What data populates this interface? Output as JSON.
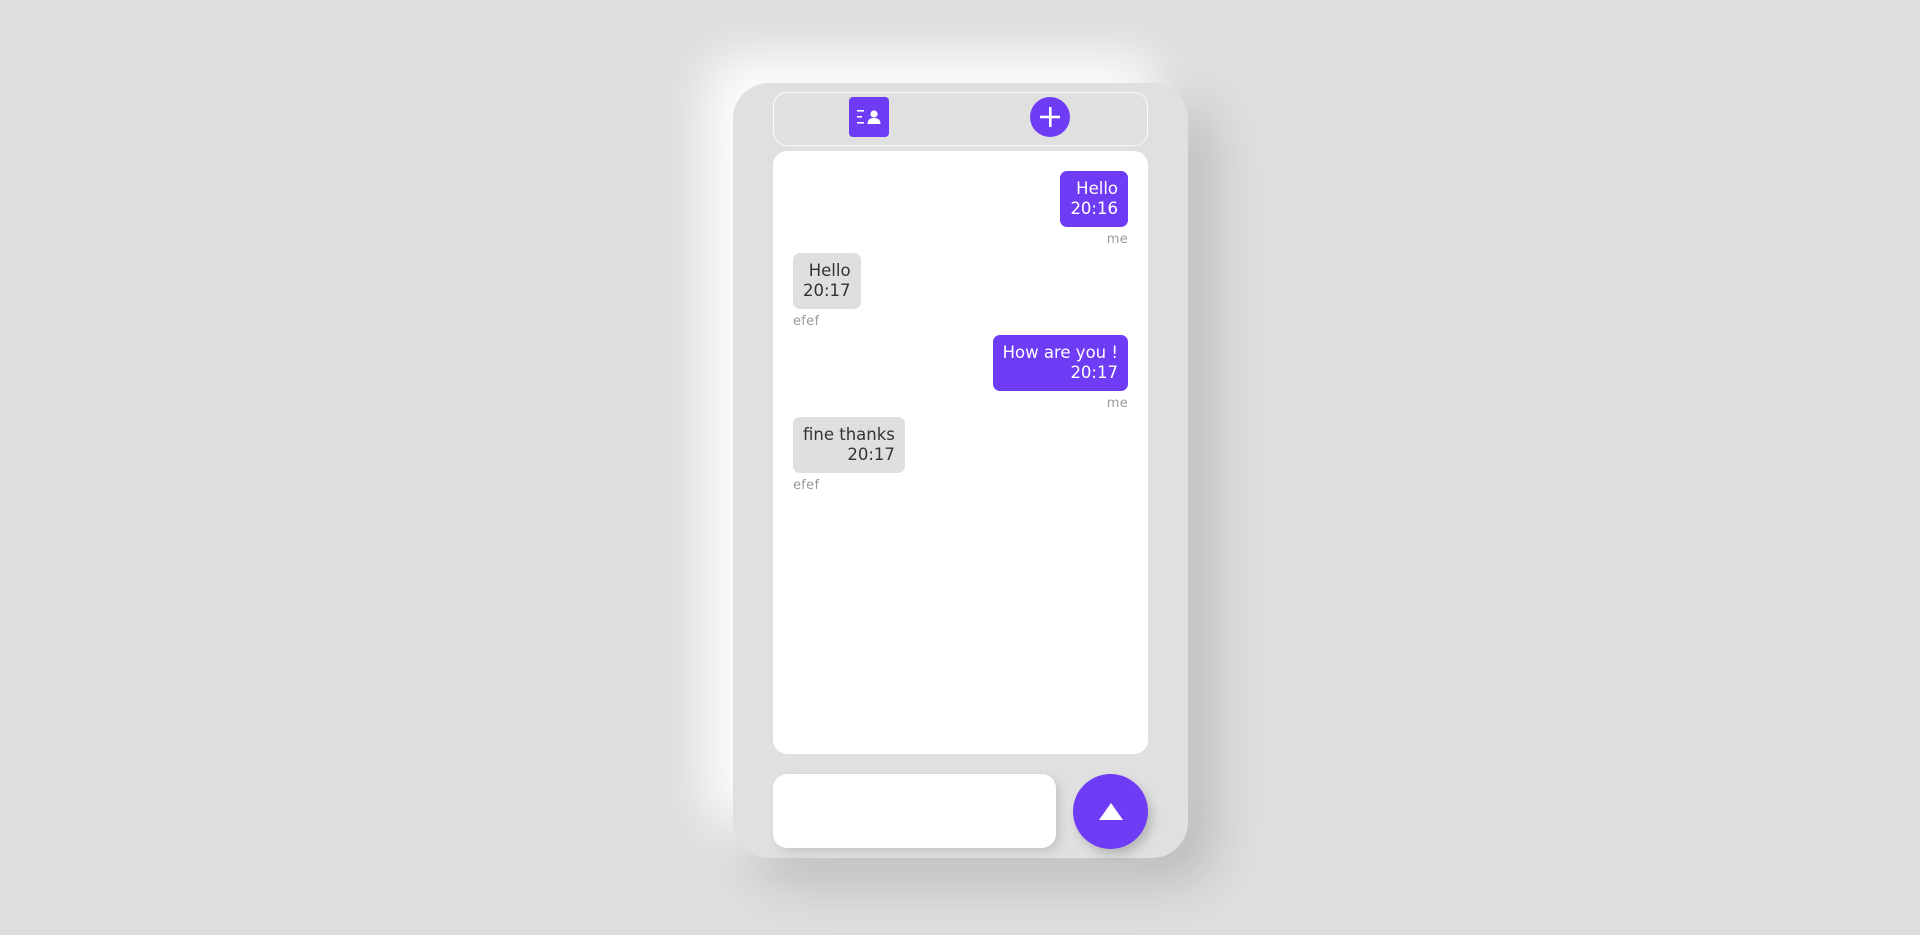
{
  "colors": {
    "accent": "#6f3cf5",
    "background": "#dedee0",
    "panel": "#e0e0e0",
    "received_bubble": "#dfdfdf"
  },
  "topbar": {
    "contacts_icon": "contacts-icon",
    "add_icon": "plus-icon"
  },
  "messages": [
    {
      "direction": "sent",
      "text": "Hello",
      "time": "20:16",
      "sender": "me"
    },
    {
      "direction": "received",
      "text": "Hello",
      "time": "20:17",
      "sender": "efef"
    },
    {
      "direction": "sent",
      "text": "How are you !",
      "time": "20:17",
      "sender": "me"
    },
    {
      "direction": "received",
      "text": "fine thanks",
      "time": "20:17",
      "sender": "efef"
    }
  ],
  "composer": {
    "value": "",
    "placeholder": "",
    "send_icon": "triangle-up-icon"
  }
}
